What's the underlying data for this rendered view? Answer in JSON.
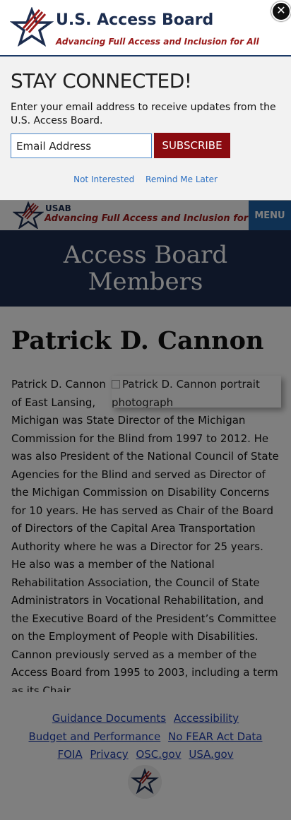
{
  "popup": {
    "org_name": "U.S. Access Board",
    "tagline": "Advancing Full Access and Inclusion for All",
    "close_label": "✕",
    "heading": "STAY CONNECTED!",
    "description": "Enter your email address to receive updates from the U.S. Access Board.",
    "email_placeholder": "Email Address",
    "email_value": "",
    "subscribe_label": "SUBSCRIBE",
    "not_interested": "Not Interested",
    "remind_later": "Remind Me Later"
  },
  "header": {
    "abbr": "USAB",
    "tagline": "Advancing Full Access and Inclusion for All",
    "menu_label": "MENU"
  },
  "hero": {
    "title": "Access Board Members"
  },
  "member": {
    "name": "Patrick D. Cannon",
    "portrait_alt": "Patrick D. Cannon portrait photograph",
    "bio": "Patrick D. Cannon of East Lansing, Michigan was State Director of the Michigan Commission for the Blind from 1997 to 2012. He was also President of the National Council of State Agencies for the Blind and served as Director of the Michigan Commission on Disability Concerns for 10 years. He has served as Chair of the Board of Directors of the Capital Area Transportation Authority where he was a Director for 25 years. He also was a member of the National Rehabilitation Association, the Council of State Administrators in Vocational Rehabilitation, and the Executive Board of the President’s Committee on the Employment of People with Disabilities. Cannon previously served as a member of the Access Board from 1995 to 2003, including a term as its Chair."
  },
  "footer": {
    "links": [
      "Guidance Documents",
      "Accessibility",
      "Budget and Performance",
      "No FEAR Act Data",
      "FOIA",
      "Privacy",
      "OSC.gov",
      "USA.gov"
    ]
  },
  "colors": {
    "navy": "#1c2d4f",
    "brand_red": "#9b1b1b",
    "subscribe_bg": "#8a0b10",
    "menu_bg": "#1f63a6",
    "link_blue": "#2b6fc2"
  }
}
